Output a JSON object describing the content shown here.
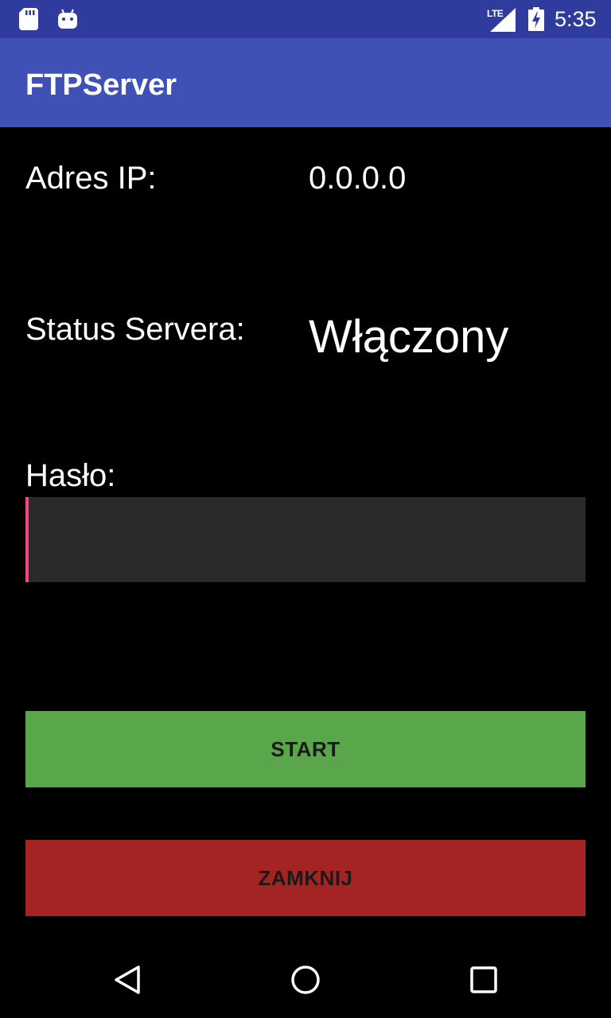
{
  "status_bar": {
    "network_label": "LTE",
    "time": "5:35",
    "icons": [
      "sd-card-icon",
      "android-debug-icon",
      "signal-icon",
      "battery-charging-icon"
    ]
  },
  "app_bar": {
    "title": "FTPServer",
    "color": "#3f51b5"
  },
  "main": {
    "ip_label": "Adres IP:",
    "ip_value": "0.0.0.0",
    "status_label": "Status Servera:",
    "status_value": "Włączony",
    "password_label": "Hasło:",
    "password_value": "",
    "accent_color": "#ff4081"
  },
  "buttons": {
    "start_label": "START",
    "start_color": "#5aa74b",
    "close_label": "ZAMKNIJ",
    "close_color": "#a42424"
  },
  "nav_bar": {
    "icons": [
      "back-icon",
      "home-icon",
      "recents-icon"
    ]
  }
}
